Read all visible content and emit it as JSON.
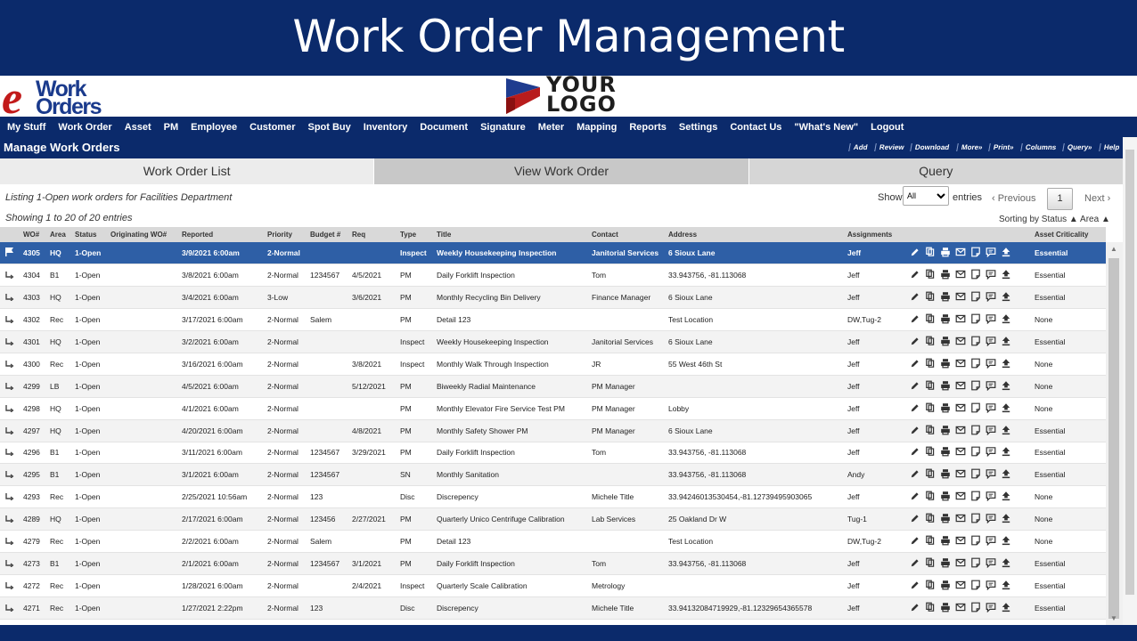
{
  "banner": {
    "title": "Work Order Management"
  },
  "logos": {
    "ewo_e": "e",
    "ewo_line1": "Work",
    "ewo_line2": "Orders",
    "your_logo_line1": "YOUR",
    "your_logo_line2": "LOGO"
  },
  "menu": [
    "My Stuff",
    "Work Order",
    "Asset",
    "PM",
    "Employee",
    "Customer",
    "Spot Buy",
    "Inventory",
    "Document",
    "Signature",
    "Meter",
    "Mapping",
    "Reports",
    "Settings",
    "Contact Us",
    "\"What's New\"",
    "Logout"
  ],
  "header": {
    "title": "Manage Work Orders",
    "actions": [
      "Add",
      "Review",
      "Download",
      "More»",
      "Print»",
      "Columns",
      "Query»",
      "Help"
    ]
  },
  "tabs": [
    "Work Order List",
    "View Work Order",
    "Query"
  ],
  "info": {
    "listing": "Listing 1-Open work orders for Facilities Department",
    "showing": "Showing 1 to 20 of 20 entries",
    "show_label": "Show",
    "show_value": "All",
    "entries_label": "entries",
    "prev": "‹ Previous",
    "page": "1",
    "next": "Next ›",
    "sorting": "Sorting by Status ▲ Area ▲"
  },
  "columns": [
    "WO#",
    "Area",
    "Status",
    "Originating WO#",
    "Reported",
    "Priority",
    "Budget #",
    "Req",
    "Type",
    "Title",
    "Contact",
    "Address",
    "Assignments",
    "",
    "Asset Criticality"
  ],
  "rows": [
    [
      "4305",
      "HQ",
      "1-Open",
      "",
      "3/9/2021 6:00am",
      "2-Normal",
      "",
      "",
      "Inspect",
      "Weekly Housekeeping Inspection",
      "Janitorial Services",
      "6 Sioux Lane",
      "Jeff",
      "Essential"
    ],
    [
      "4304",
      "B1",
      "1-Open",
      "",
      "3/8/2021 6:00am",
      "2-Normal",
      "1234567",
      "4/5/2021",
      "PM",
      "Daily Forklift Inspection",
      "Tom",
      "33.943756, -81.113068",
      "Jeff",
      "Essential"
    ],
    [
      "4303",
      "HQ",
      "1-Open",
      "",
      "3/4/2021 6:00am",
      "3-Low",
      "",
      "3/6/2021",
      "PM",
      "Monthly Recycling Bin Delivery",
      "Finance Manager",
      "6 Sioux Lane",
      "Jeff",
      "Essential"
    ],
    [
      "4302",
      "Rec",
      "1-Open",
      "",
      "3/17/2021 6:00am",
      "2-Normal",
      "Salem",
      "",
      "PM",
      "Detail 123",
      "",
      "Test Location",
      "DW,Tug-2",
      "None"
    ],
    [
      "4301",
      "HQ",
      "1-Open",
      "",
      "3/2/2021 6:00am",
      "2-Normal",
      "",
      "",
      "Inspect",
      "Weekly Housekeeping Inspection",
      "Janitorial Services",
      "6 Sioux Lane",
      "Jeff",
      "Essential"
    ],
    [
      "4300",
      "Rec",
      "1-Open",
      "",
      "3/16/2021 6:00am",
      "2-Normal",
      "",
      "3/8/2021",
      "Inspect",
      "Monthly Walk Through Inspection",
      "JR",
      "55 West 46th St",
      "Jeff",
      "None"
    ],
    [
      "4299",
      "LB",
      "1-Open",
      "",
      "4/5/2021 6:00am",
      "2-Normal",
      "",
      "5/12/2021",
      "PM",
      "Biweekly Radial Maintenance",
      "PM Manager",
      "",
      "Jeff",
      "None"
    ],
    [
      "4298",
      "HQ",
      "1-Open",
      "",
      "4/1/2021 6:00am",
      "2-Normal",
      "",
      "",
      "PM",
      "Monthly Elevator Fire Service Test PM",
      "PM Manager",
      "Lobby",
      "Jeff",
      "None"
    ],
    [
      "4297",
      "HQ",
      "1-Open",
      "",
      "4/20/2021 6:00am",
      "2-Normal",
      "",
      "4/8/2021",
      "PM",
      "Monthly Safety Shower PM",
      "PM Manager",
      "6 Sioux Lane",
      "Jeff",
      "Essential"
    ],
    [
      "4296",
      "B1",
      "1-Open",
      "",
      "3/11/2021 6:00am",
      "2-Normal",
      "1234567",
      "3/29/2021",
      "PM",
      "Daily Forklift Inspection",
      "Tom",
      "33.943756, -81.113068",
      "Jeff",
      "Essential"
    ],
    [
      "4295",
      "B1",
      "1-Open",
      "",
      "3/1/2021 6:00am",
      "2-Normal",
      "1234567",
      "",
      "SN",
      "Monthly Sanitation",
      "",
      "33.943756, -81.113068",
      "Andy",
      "Essential"
    ],
    [
      "4293",
      "Rec",
      "1-Open",
      "",
      "2/25/2021 10:56am",
      "2-Normal",
      "123",
      "",
      "Disc",
      "Discrepency",
      "Michele Title",
      "33.94246013530454,-81.12739495903065",
      "Jeff",
      "None"
    ],
    [
      "4289",
      "HQ",
      "1-Open",
      "",
      "2/17/2021 6:00am",
      "2-Normal",
      "123456",
      "2/27/2021",
      "PM",
      "Quarterly Unico Centrifuge Calibration",
      "Lab Services",
      "25 Oakland Dr W",
      "Tug-1",
      "None"
    ],
    [
      "4279",
      "Rec",
      "1-Open",
      "",
      "2/2/2021 6:00am",
      "2-Normal",
      "Salem",
      "",
      "PM",
      "Detail 123",
      "",
      "Test Location",
      "DW,Tug-2",
      "None"
    ],
    [
      "4273",
      "B1",
      "1-Open",
      "",
      "2/1/2021 6:00am",
      "2-Normal",
      "1234567",
      "3/1/2021",
      "PM",
      "Daily Forklift Inspection",
      "Tom",
      "33.943756, -81.113068",
      "Jeff",
      "Essential"
    ],
    [
      "4272",
      "Rec",
      "1-Open",
      "",
      "1/28/2021 6:00am",
      "2-Normal",
      "",
      "2/4/2021",
      "Inspect",
      "Quarterly Scale Calibration",
      "Metrology",
      "",
      "Jeff",
      "Essential"
    ],
    [
      "4271",
      "Rec",
      "1-Open",
      "",
      "1/27/2021 2:22pm",
      "2-Normal",
      "123",
      "",
      "Disc",
      "Discrepency",
      "Michele Title",
      "33.94132084719929,-81.12329654365578",
      "Jeff",
      "Essential"
    ]
  ],
  "row_icons": [
    "pencil-icon",
    "copy-icon",
    "print-icon",
    "email-icon",
    "note-icon",
    "comment-icon",
    "upload-icon"
  ],
  "colors": {
    "navy": "#0b2a6b",
    "selected_row": "#2e5fa6",
    "brand_red": "#c21a1a",
    "brand_blue": "#1a3a8c"
  }
}
